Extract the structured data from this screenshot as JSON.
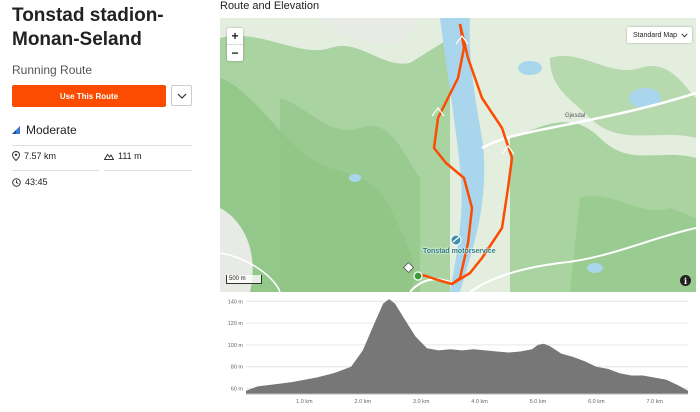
{
  "route": {
    "title": "Tonstad stadion-Monan-Seland",
    "type": "Running Route",
    "use_button": "Use This Route",
    "difficulty": "Moderate",
    "stats": {
      "distance": "7.57 km",
      "elevation": "111 m",
      "time": "43:45"
    }
  },
  "map": {
    "heading": "Route and Elevation",
    "zoom_in": "+",
    "zoom_out": "−",
    "map_type": "Standard Map",
    "scale": "500 m",
    "info": "i",
    "poi": "Tonstad motorservice",
    "place": "Gjesdal",
    "colors": {
      "route": "#fc4c02",
      "water": "#a9d6ec",
      "forest": "#a9d3a0",
      "land": "#e4eedf"
    }
  },
  "chart_data": {
    "type": "area",
    "x_unit": "km",
    "x_tick_labels": [
      "1.0 km",
      "2.0 km",
      "3.0 km",
      "4.0 km",
      "5.0 km",
      "6.0 km",
      "7.0 km"
    ],
    "x_ticks": [
      1,
      2,
      3,
      4,
      5,
      6,
      7
    ],
    "y_tick_labels": [
      "140 m",
      "120 m",
      "100 m",
      "80 m",
      "60 m"
    ],
    "y_ticks": [
      140,
      120,
      100,
      80,
      60
    ],
    "xlim": [
      0,
      7.57
    ],
    "ylim": [
      55,
      143
    ],
    "grid": true,
    "x": [
      0,
      0.2,
      0.5,
      0.8,
      1.0,
      1.2,
      1.5,
      1.8,
      2.0,
      2.2,
      2.35,
      2.45,
      2.55,
      2.7,
      2.9,
      3.1,
      3.3,
      3.5,
      3.7,
      3.9,
      4.1,
      4.3,
      4.5,
      4.7,
      4.9,
      5.0,
      5.1,
      5.2,
      5.4,
      5.6,
      5.8,
      6.0,
      6.2,
      6.4,
      6.6,
      6.8,
      7.0,
      7.2,
      7.4,
      7.57
    ],
    "values": [
      58,
      62,
      64,
      66,
      68,
      70,
      74,
      80,
      95,
      120,
      138,
      142,
      138,
      125,
      108,
      97,
      95,
      96,
      95,
      96,
      95,
      94,
      93,
      94,
      96,
      100,
      101,
      99,
      92,
      89,
      85,
      80,
      78,
      74,
      72,
      72,
      70,
      68,
      63,
      58
    ],
    "color": "#777777"
  }
}
